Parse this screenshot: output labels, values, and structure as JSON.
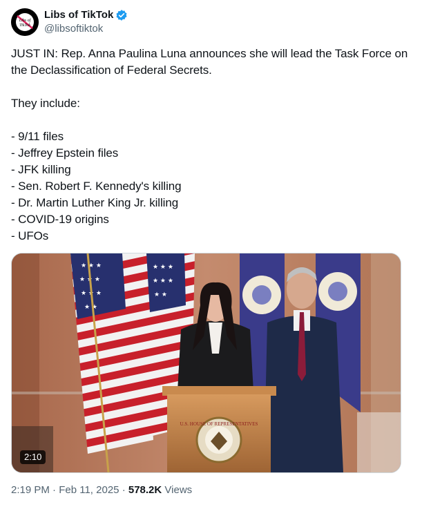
{
  "author": {
    "name": "Libs of TikTok",
    "handle": "@libsoftiktok",
    "avatar_text_line1": "Libs of",
    "avatar_text_line2": "TikTok",
    "verified_color": "#1d9bf0"
  },
  "tweet": {
    "text": "JUST IN: Rep. Anna Paulina Luna announces she will lead the Task Force on the Declassification of Federal Secrets.\n\nThey include:\n\n- 9/11 files\n- Jeffrey Epstein files\n- JFK killing\n- Sen. Robert F. Kennedy's killing\n- Dr. Martin Luther King Jr. killing\n- COVID-19 origins\n- UFOs"
  },
  "media": {
    "type": "video",
    "duration": "2:10",
    "seal_text": "U.S. HOUSE OF REPRESENTATIVES"
  },
  "meta": {
    "time": "2:19 PM",
    "separator": "·",
    "date": "Feb 11, 2025",
    "views_count": "578.2K",
    "views_label": "Views"
  }
}
